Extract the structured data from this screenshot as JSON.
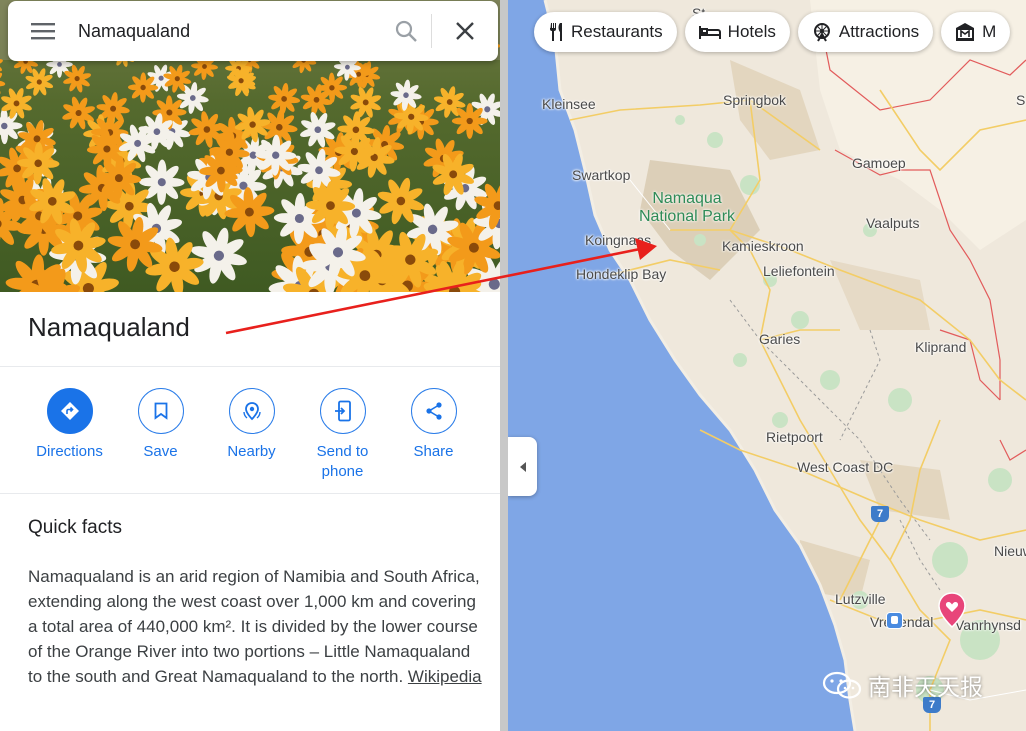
{
  "search": {
    "query": "Namaqualand"
  },
  "place": {
    "title": "Namaqualand"
  },
  "actions": [
    {
      "label": "Directions"
    },
    {
      "label": "Save"
    },
    {
      "label": "Nearby"
    },
    {
      "label": "Send to phone"
    },
    {
      "label": "Share"
    }
  ],
  "quick_facts": {
    "title": "Quick facts",
    "text": "Namaqualand is an arid region of Namibia and South Africa, extending along the west coast over 1,000 km and covering a total area of 440,000 km². It is divided by the lower course of the Orange River into two portions – Little Namaqualand to the south and Great Namaqualand to the north. ",
    "source_link": "Wikipedia"
  },
  "chips": [
    {
      "label": "Restaurants",
      "icon": "fork-knife-icon"
    },
    {
      "label": "Hotels",
      "icon": "bed-icon"
    },
    {
      "label": "Attractions",
      "icon": "ferris-wheel-icon"
    },
    {
      "label": "M",
      "icon": "museum-icon"
    }
  ],
  "map": {
    "places": {
      "kleinsee": "Kleinsee",
      "springbok": "Springbok",
      "gamoep": "Gamoep",
      "swartkop": "Swartkop",
      "park": "Namaqua National Park",
      "vaalputs": "Vaalputs",
      "koingnaas": "Koingnaas",
      "kamieskroon": "Kamieskroon",
      "hondeklip_bay": "Hondeklip Bay",
      "leliefontein": "Leliefontein",
      "garies": "Garies",
      "kliprand": "Kliprand",
      "rietpoort": "Rietpoort",
      "west_coast_dc": "West Coast DC",
      "lutzville": "Lutzville",
      "vredendal": "Vredendal",
      "vanrhynsdorp": "Vanrhynsd",
      "nieuw": "Nieuw",
      "st": "St",
      "s": "S"
    },
    "route_shields": [
      "7",
      "7"
    ],
    "colors": {
      "water": "#7fa6e6",
      "land": "#efe8dc",
      "accent": "#1a73e8",
      "pin": "#e8457a",
      "annotation": "#e8201c"
    }
  },
  "watermark": {
    "text": "南非天天报"
  }
}
